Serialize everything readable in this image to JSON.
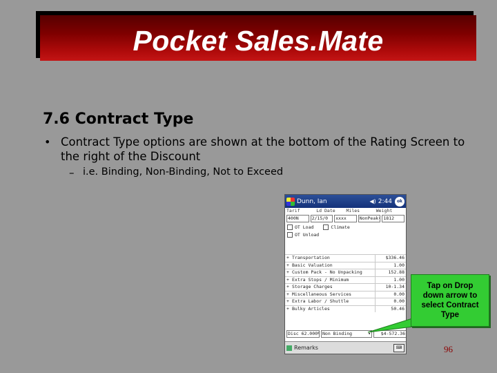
{
  "slide": {
    "title": "Pocket Sales.Mate",
    "heading": "7.6 Contract Type",
    "bullet_marker": "•",
    "bullet": "Contract Type options are shown at the bottom of the Rating Screen to the right of the Discount",
    "sub_marker": "–",
    "sub_bullet": "i.e. Binding, Non-Binding, Not to Exceed",
    "callout": "Tap on Drop down arrow to select Contract Type",
    "page_number": "96",
    "colors": {
      "banner": "#8b0000",
      "background": "#999999",
      "callout": "#33cc33",
      "page_number": "#8b0000"
    }
  },
  "device": {
    "top_bar": {
      "start_icon": "windows-flag-icon",
      "title": "Dunn, Ian",
      "volume_icon": "speaker-icon",
      "time": "2:44",
      "ok": "ok"
    },
    "header_labels": [
      "Tarif",
      "Ld Date",
      "Miles",
      "Weight"
    ],
    "fields": [
      "400N",
      "2/15/0",
      "xxxx",
      "NonPeak",
      "1812"
    ],
    "checkboxes": [
      {
        "label": "OT Load",
        "checked": false
      },
      {
        "label": "Climate",
        "checked": false
      },
      {
        "label": "OT Unload",
        "checked": false
      }
    ],
    "rates": [
      {
        "name": "Transportation",
        "value": "$336.46"
      },
      {
        "name": "Basic Valuation",
        "value": "1.00"
      },
      {
        "name": "Custom Pack - No Unpacking",
        "value": "152.88"
      },
      {
        "name": "Extra Stops / Minimum",
        "value": "1.00"
      },
      {
        "name": "Storage Charges",
        "value": "10-1.34"
      },
      {
        "name": "Miscellaneous Services",
        "value": "0.00"
      },
      {
        "name": "Extra Labor / Shuttle",
        "value": "0.00"
      },
      {
        "name": "Bulky Articles",
        "value": "50.46"
      }
    ],
    "discount": "Disc 62.000%",
    "contract_type": "Non Binding",
    "total": "$4-572.36",
    "menu": {
      "remarks": "Remarks",
      "keyboard_icon": "keyboard-icon"
    }
  }
}
